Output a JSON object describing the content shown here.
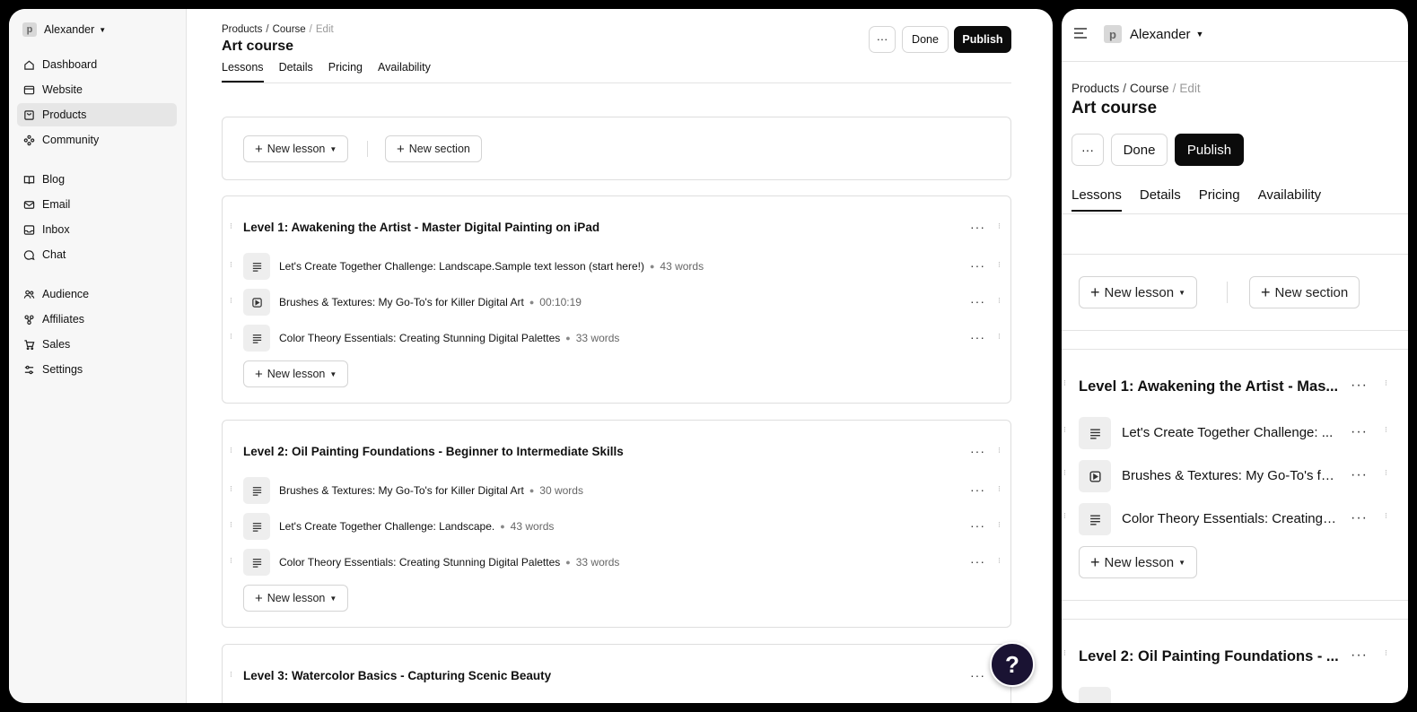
{
  "workspace": {
    "name": "Alexander",
    "logo_letter": "p"
  },
  "sidebar": {
    "items": [
      {
        "label": "Dashboard",
        "icon": "home-icon"
      },
      {
        "label": "Website",
        "icon": "browser-icon"
      },
      {
        "label": "Products",
        "icon": "bag-icon",
        "active": true
      },
      {
        "label": "Community",
        "icon": "community-icon"
      },
      {
        "label": "Blog",
        "icon": "book-icon"
      },
      {
        "label": "Email",
        "icon": "mail-icon"
      },
      {
        "label": "Inbox",
        "icon": "inbox-icon"
      },
      {
        "label": "Chat",
        "icon": "chat-icon"
      },
      {
        "label": "Audience",
        "icon": "users-icon"
      },
      {
        "label": "Affiliates",
        "icon": "affiliates-icon"
      },
      {
        "label": "Sales",
        "icon": "cart-icon"
      },
      {
        "label": "Settings",
        "icon": "sliders-icon"
      }
    ]
  },
  "breadcrumb": {
    "items": [
      "Products",
      "Course",
      "Edit"
    ],
    "separator": "/"
  },
  "page": {
    "title": "Art course"
  },
  "actions": {
    "more": "···",
    "done": "Done",
    "publish": "Publish"
  },
  "tabs": [
    "Lessons",
    "Details",
    "Pricing",
    "Availability"
  ],
  "toolbar": {
    "new_lesson": "New lesson",
    "new_section": "New section"
  },
  "sections": [
    {
      "title": "Level 1: Awakening the Artist - Master Digital Painting on iPad",
      "lessons": [
        {
          "title": "Let's Create Together Challenge: Landscape.Sample text lesson (start here!)",
          "meta": "43 words",
          "type": "text"
        },
        {
          "title": "Brushes & Textures: My Go-To's for Killer Digital Art",
          "meta": "00:10:19",
          "type": "video"
        },
        {
          "title": "Color Theory Essentials: Creating Stunning Digital Palettes",
          "meta": "33 words",
          "type": "text"
        }
      ]
    },
    {
      "title": "Level 2: Oil Painting Foundations - Beginner to Intermediate Skills",
      "lessons": [
        {
          "title": "Brushes & Textures: My Go-To's for Killer Digital Art",
          "meta": "30 words",
          "type": "text"
        },
        {
          "title": "Let's Create Together Challenge: Landscape.",
          "meta": "43 words",
          "type": "text"
        },
        {
          "title": "Color Theory Essentials: Creating Stunning Digital Palettes",
          "meta": "33 words",
          "type": "text"
        }
      ]
    },
    {
      "title": "Level 3: Watercolor Basics - Capturing Scenic Beauty",
      "lessons": []
    }
  ],
  "mobile": {
    "section1_title": "Level 1: Awakening the Artist - Mas...",
    "lessons": [
      "Let's Create Together Challenge: ...",
      "Brushes & Textures: My Go-To's fo...",
      "Color Theory Essentials: Creating ..."
    ],
    "section2_title": "Level 2: Oil Painting Foundations - ..."
  },
  "help": {
    "label": "?"
  },
  "colors": {
    "accent": "#0b0b0b",
    "help_bg": "#1a1333",
    "active_nav": "#e6e6e6"
  }
}
